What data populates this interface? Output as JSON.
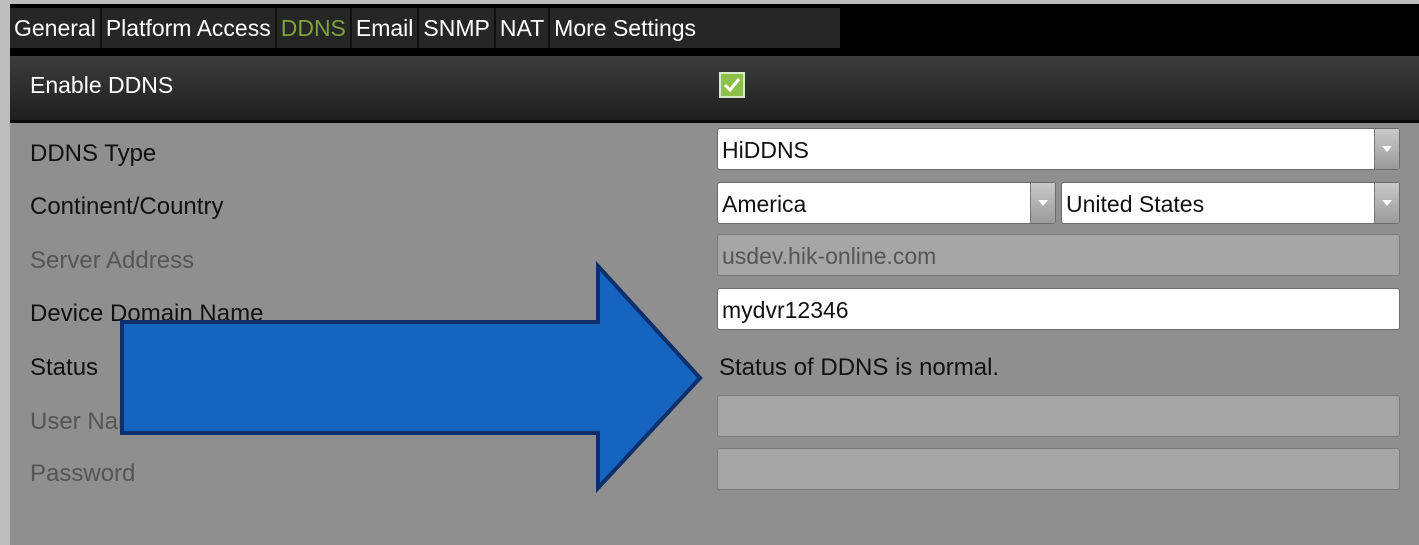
{
  "tabs": [
    "General",
    "Platform Access",
    "DDNS",
    "Email",
    "SNMP",
    "NAT",
    "More Settings"
  ],
  "active_tab": "DDNS",
  "enable_ddns": {
    "label": "Enable DDNS",
    "checked": true
  },
  "form": {
    "ddns_type": {
      "label": "DDNS Type",
      "value": "HiDDNS"
    },
    "continent_country": {
      "label": "Continent/Country",
      "continent": "America",
      "country": "United States"
    },
    "server_address": {
      "label": "Server Address",
      "value": "usdev.hik-online.com"
    },
    "device_domain_name": {
      "label": "Device Domain Name",
      "value": "mydvr12346"
    },
    "status": {
      "label": "Status",
      "value": "Status of DDNS is normal."
    },
    "user_name": {
      "label": "User Name",
      "value": ""
    },
    "password": {
      "label": "Password",
      "value": ""
    }
  },
  "colors": {
    "active_tab": "#7ea33a",
    "arrow_fill": "#1565c0",
    "arrow_stroke": "#0d2f6b",
    "checkbox": "#8cc04a"
  }
}
